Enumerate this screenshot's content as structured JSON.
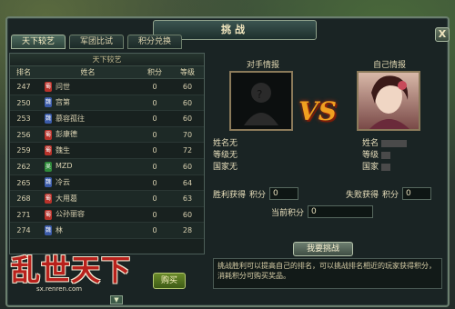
{
  "window": {
    "title": "挑战"
  },
  "tabs": [
    {
      "label": "天下较艺",
      "active": true
    },
    {
      "label": "军团比试",
      "active": false
    },
    {
      "label": "积分兑换",
      "active": false
    }
  ],
  "ranking": {
    "heading": "天下较艺",
    "columns": {
      "rank": "排名",
      "name": "姓名",
      "score": "积分",
      "level": "等级"
    },
    "rows": [
      {
        "rank": "247",
        "faction": "蜀",
        "faction_color": "#b8322a",
        "name": "问世",
        "score": "0",
        "level": "60"
      },
      {
        "rank": "250",
        "faction": "魏",
        "faction_color": "#3a5aa8",
        "name": "宫第",
        "score": "0",
        "level": "60"
      },
      {
        "rank": "253",
        "faction": "魏",
        "faction_color": "#3a5aa8",
        "name": "慕容孤往",
        "score": "0",
        "level": "60"
      },
      {
        "rank": "256",
        "faction": "蜀",
        "faction_color": "#b8322a",
        "name": "彭康德",
        "score": "0",
        "level": "70"
      },
      {
        "rank": "259",
        "faction": "蜀",
        "faction_color": "#b8322a",
        "name": "魏生",
        "score": "0",
        "level": "72"
      },
      {
        "rank": "262",
        "faction": "吴",
        "faction_color": "#2e8a3a",
        "name": "MZD",
        "score": "0",
        "level": "60"
      },
      {
        "rank": "265",
        "faction": "魏",
        "faction_color": "#3a5aa8",
        "name": "冷云",
        "score": "0",
        "level": "64"
      },
      {
        "rank": "268",
        "faction": "蜀",
        "faction_color": "#b8322a",
        "name": "大用葛",
        "score": "0",
        "level": "63"
      },
      {
        "rank": "271",
        "faction": "蜀",
        "faction_color": "#b8322a",
        "name": "公孙丽容",
        "score": "0",
        "level": "60"
      },
      {
        "rank": "274",
        "faction": "魏",
        "faction_color": "#3a5aa8",
        "name": "林",
        "score": "0",
        "level": "28"
      }
    ]
  },
  "logo": {
    "text": "乱世天下",
    "url": "sx.renren.com"
  },
  "buttons": {
    "buy": "购买",
    "challenge": "我要挑战",
    "close": "X",
    "scroll": "▼"
  },
  "opponent": {
    "title": "对手情报",
    "name_label": "姓名",
    "name_value": "无",
    "level_label": "等级",
    "level_value": "无",
    "country_label": "国家",
    "country_value": "无",
    "win_label": "胜利获得",
    "win_score_label": "积分",
    "win_score": "0"
  },
  "self": {
    "title": "自己情报",
    "name_label": "姓名",
    "level_label": "等级",
    "country_label": "国家",
    "lose_label": "失败获得",
    "lose_score_label": "积分",
    "lose_score": "0"
  },
  "current_score": {
    "label": "当前积分",
    "value": "0"
  },
  "vs_text": "VS",
  "description": "挑战胜利可以提高自己的排名，可以挑战排名相近的玩家获得积分，消耗积分可购买奖品。",
  "colors": {
    "accent_gold": "#f0a020",
    "panel_border": "#6b7f6e",
    "buy_green": "#5a7a22"
  }
}
